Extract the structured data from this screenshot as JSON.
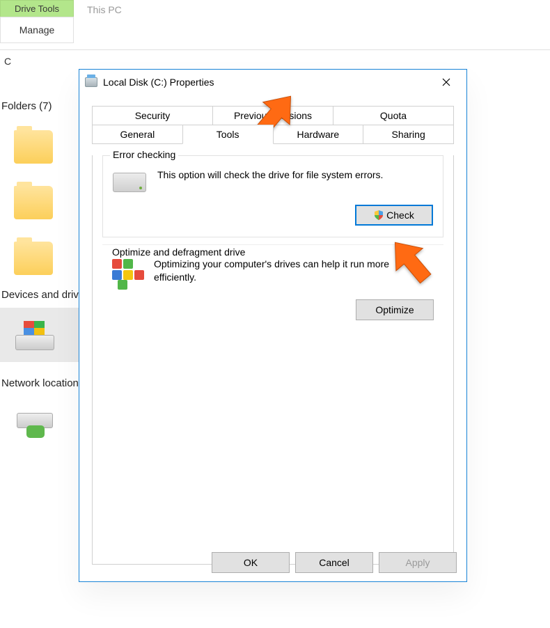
{
  "explorer": {
    "context_tab": "Drive Tools",
    "ribbon_tab": "Manage",
    "title": "This PC",
    "breadcrumb": "C",
    "sections": {
      "folders": "Folders (7)",
      "devices": "Devices and drives",
      "network": "Network locations"
    }
  },
  "dialog": {
    "title": "Local Disk (C:) Properties",
    "tabs_row1": [
      "Security",
      "Previous Versions",
      "Quota"
    ],
    "tabs_row2": [
      "General",
      "Tools",
      "Hardware",
      "Sharing"
    ],
    "active_tab": "Tools",
    "error_checking": {
      "title": "Error checking",
      "text": "This option will check the drive for file system errors.",
      "button": "Check"
    },
    "optimize": {
      "title": "Optimize and defragment drive",
      "text": "Optimizing your computer's drives can help it run more efficiently.",
      "button": "Optimize"
    },
    "footer": {
      "ok": "OK",
      "cancel": "Cancel",
      "apply": "Apply"
    }
  }
}
